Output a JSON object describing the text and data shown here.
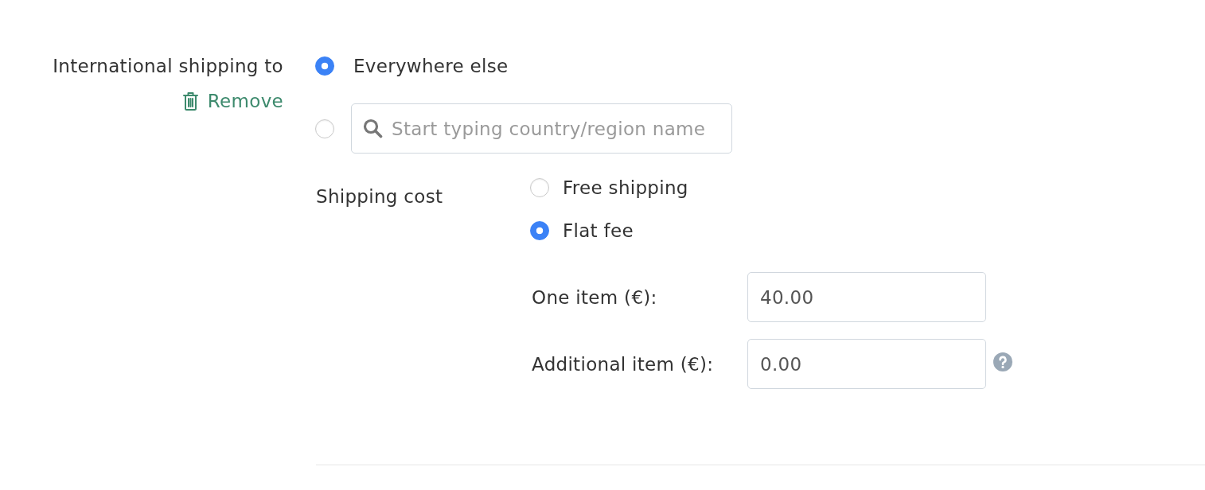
{
  "international_shipping": {
    "label": "International shipping to",
    "remove_link": "Remove",
    "destinations": [
      {
        "kind": "option",
        "label": "Everywhere else",
        "selected": true
      },
      {
        "kind": "search",
        "placeholder": "Start typing country/region name",
        "selected": false
      }
    ]
  },
  "shipping_cost": {
    "label": "Shipping cost",
    "options": [
      {
        "label": "Free shipping",
        "selected": false
      },
      {
        "label": "Flat fee",
        "selected": true
      }
    ],
    "fields": [
      {
        "label": "One item (€):",
        "value": "40.00"
      },
      {
        "label": "Additional item (€):",
        "value": "0.00",
        "help": true
      }
    ]
  }
}
